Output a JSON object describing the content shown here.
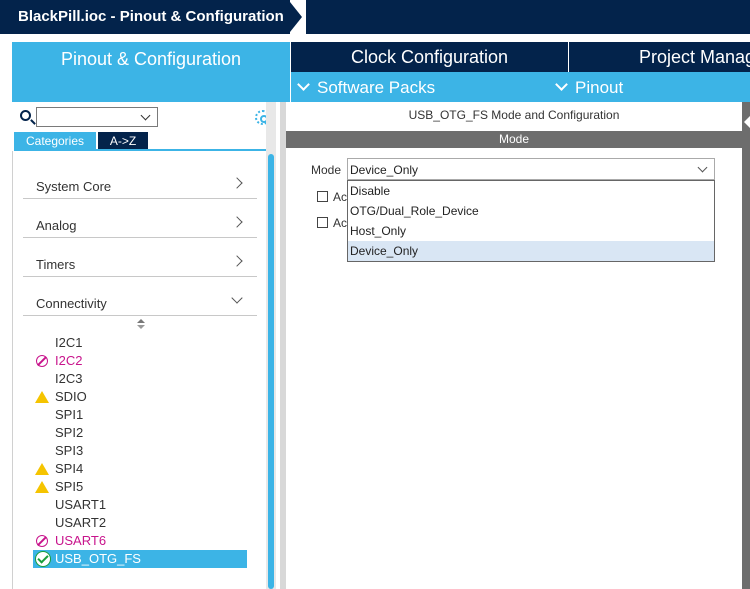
{
  "window": {
    "title": "BlackPill.ioc - Pinout & Configuration"
  },
  "tabs": [
    {
      "label": "Pinout & Configuration",
      "active": true
    },
    {
      "label": "Clock Configuration",
      "active": false
    },
    {
      "label": "Project Manag",
      "active": false
    }
  ],
  "subnav": {
    "software_packs": "Software Packs",
    "pinout": "Pinout"
  },
  "left": {
    "search": {
      "value": ""
    },
    "cat_tabs": {
      "categories": "Categories",
      "az": "A->Z"
    },
    "categories": [
      {
        "label": "System Core",
        "expanded": false
      },
      {
        "label": "Analog",
        "expanded": false
      },
      {
        "label": "Timers",
        "expanded": false
      },
      {
        "label": "Connectivity",
        "expanded": true
      }
    ],
    "peripherals": [
      {
        "label": "I2C1",
        "status": "none"
      },
      {
        "label": "I2C2",
        "status": "error"
      },
      {
        "label": "I2C3",
        "status": "none"
      },
      {
        "label": "SDIO",
        "status": "warning"
      },
      {
        "label": "SPI1",
        "status": "none"
      },
      {
        "label": "SPI2",
        "status": "none"
      },
      {
        "label": "SPI3",
        "status": "none"
      },
      {
        "label": "SPI4",
        "status": "warning"
      },
      {
        "label": "SPI5",
        "status": "warning"
      },
      {
        "label": "USART1",
        "status": "none"
      },
      {
        "label": "USART2",
        "status": "none"
      },
      {
        "label": "USART6",
        "status": "error"
      },
      {
        "label": "USB_OTG_FS",
        "status": "ok",
        "selected": true
      }
    ]
  },
  "right": {
    "title": "USB_OTG_FS Mode and Configuration",
    "mode_header": "Mode",
    "mode_label": "Mode",
    "mode_value": "Device_Only",
    "checkbox_1": "Ac",
    "checkbox_2": "Ac",
    "dropdown_options": [
      "Disable",
      "OTG/Dual_Role_Device",
      "Host_Only",
      "Device_Only"
    ],
    "dropdown_selected_index": 3
  },
  "colors": {
    "navy": "#03234b",
    "accent": "#3cb4e6",
    "error": "#c8148c",
    "warning": "#f5c400",
    "ok": "#1a9e3a"
  }
}
